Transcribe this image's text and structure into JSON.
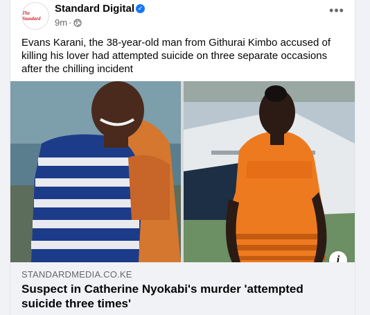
{
  "post": {
    "page_name": "Standard Digital",
    "avatar_text": "The Standard",
    "time": "9m",
    "meta_separator": "·",
    "more_label": "•••",
    "caption": "Evans Karani, the 38-year-old man from Githurai Kimbo accused of killing his lover had attempted suicide on three separate occasions after the chilling incident"
  },
  "link": {
    "domain": "STANDARDMEDIA.CO.KE",
    "headline": "Suspect in Catherine Nyokabi's murder 'attempted suicide three times'",
    "info_label": "i"
  },
  "icons": {
    "verified": "verified-badge-icon",
    "privacy": "globe-icon",
    "more": "more-options-icon",
    "info": "info-icon"
  },
  "colors": {
    "brand": "#1877f2",
    "avatar_red": "#d61f26",
    "text": "#050505",
    "secondary": "#65676b"
  }
}
